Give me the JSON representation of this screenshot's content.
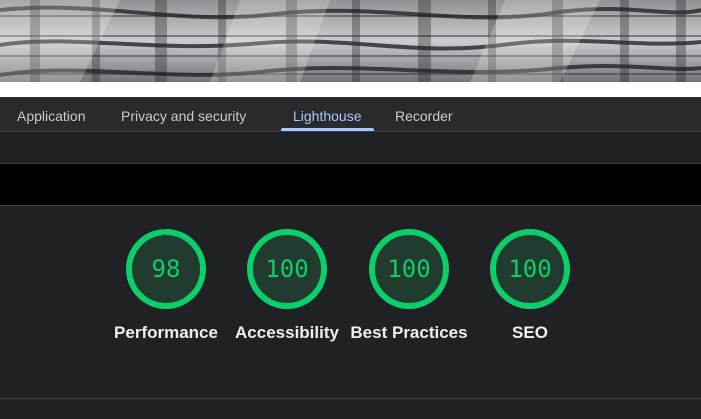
{
  "devtools": {
    "tabs": [
      {
        "label": "Application"
      },
      {
        "label": "Privacy and security"
      },
      {
        "label": "Lighthouse"
      },
      {
        "label": "Recorder"
      }
    ],
    "active_tab": "Lighthouse"
  },
  "lighthouse": {
    "gauges": [
      {
        "score": "98",
        "label": "Performance",
        "fraction": 0.98
      },
      {
        "score": "100",
        "label": "Accessibility",
        "fraction": 1.0
      },
      {
        "score": "100",
        "label": "Best Practices",
        "fraction": 1.0
      },
      {
        "score": "100",
        "label": "SEO",
        "fraction": 1.0
      }
    ]
  },
  "colors": {
    "pass": "#0cce6b",
    "pass_fill": "#223b2f",
    "active_tab": "#a8c7fa"
  }
}
